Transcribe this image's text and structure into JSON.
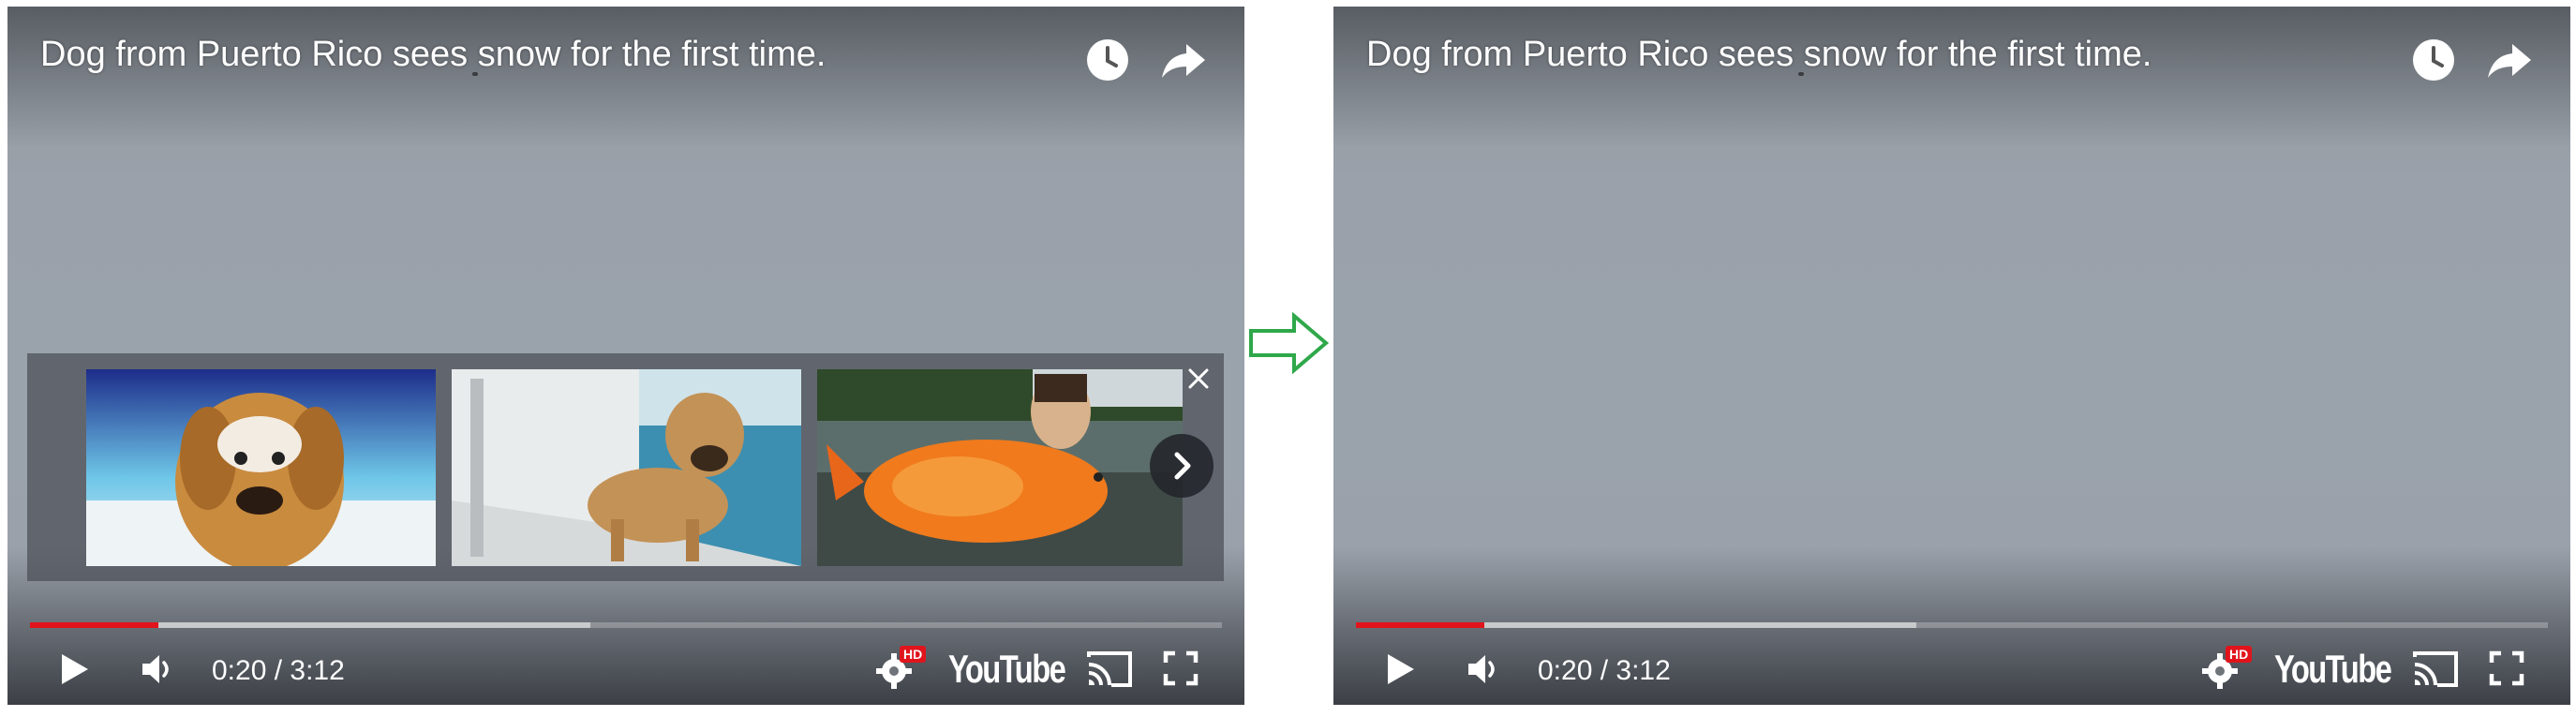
{
  "before": {
    "title": "Dog from Puerto Rico sees snow for the first time.",
    "time": "0:20 / 3:12",
    "progress": {
      "played_fraction": 0.108,
      "loaded_fraction": 0.47
    },
    "hd_badge": "HD",
    "youtube_logo": "YouTube",
    "suggestions": [
      {
        "thumbnail": "snowy golden retriever"
      },
      {
        "thumbnail": "dog on boat"
      },
      {
        "thumbnail": "man holding giant goldfish"
      }
    ]
  },
  "after": {
    "title": "Dog from Puerto Rico sees snow for the first time.",
    "time": "0:20 / 3:12",
    "progress": {
      "played_fraction": 0.108,
      "loaded_fraction": 0.47
    },
    "hd_badge": "HD",
    "youtube_logo": "YouTube"
  },
  "icons": {
    "watch_later": "clock-icon",
    "share": "share-arrow-icon",
    "close": "close-icon",
    "next": "chevron-right-icon",
    "play": "play-icon",
    "volume": "volume-icon",
    "settings": "gear-icon",
    "cast": "cast-icon",
    "fullscreen": "fullscreen-icon",
    "transition": "right-arrow-icon"
  },
  "colors": {
    "progress_played": "#e1141c",
    "hd_badge": "#e1141c",
    "transition_arrow": "#2fa84a"
  }
}
